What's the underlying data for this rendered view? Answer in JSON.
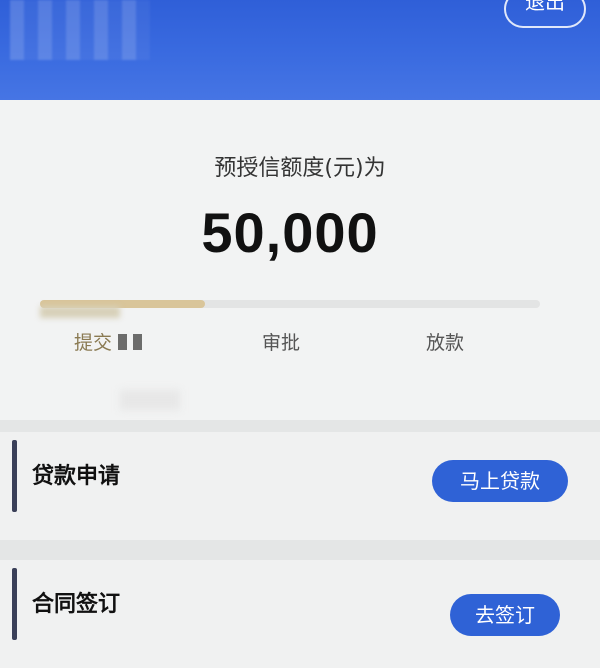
{
  "header": {
    "logout_label": "退出"
  },
  "quota": {
    "label": "预授信额度(元)为",
    "amount": "50,000"
  },
  "progress": {
    "fraction": 0.33,
    "steps": [
      "提交",
      "审批",
      "放款"
    ]
  },
  "sections": {
    "loan": {
      "title": "贷款申请",
      "button_label": "马上贷款"
    },
    "contract": {
      "title": "合同签订",
      "button_label": "去签订"
    }
  },
  "colors": {
    "header_blue": "#3a6be0",
    "button_blue": "#2f62d6",
    "progress_gold": "#d9c59a"
  }
}
